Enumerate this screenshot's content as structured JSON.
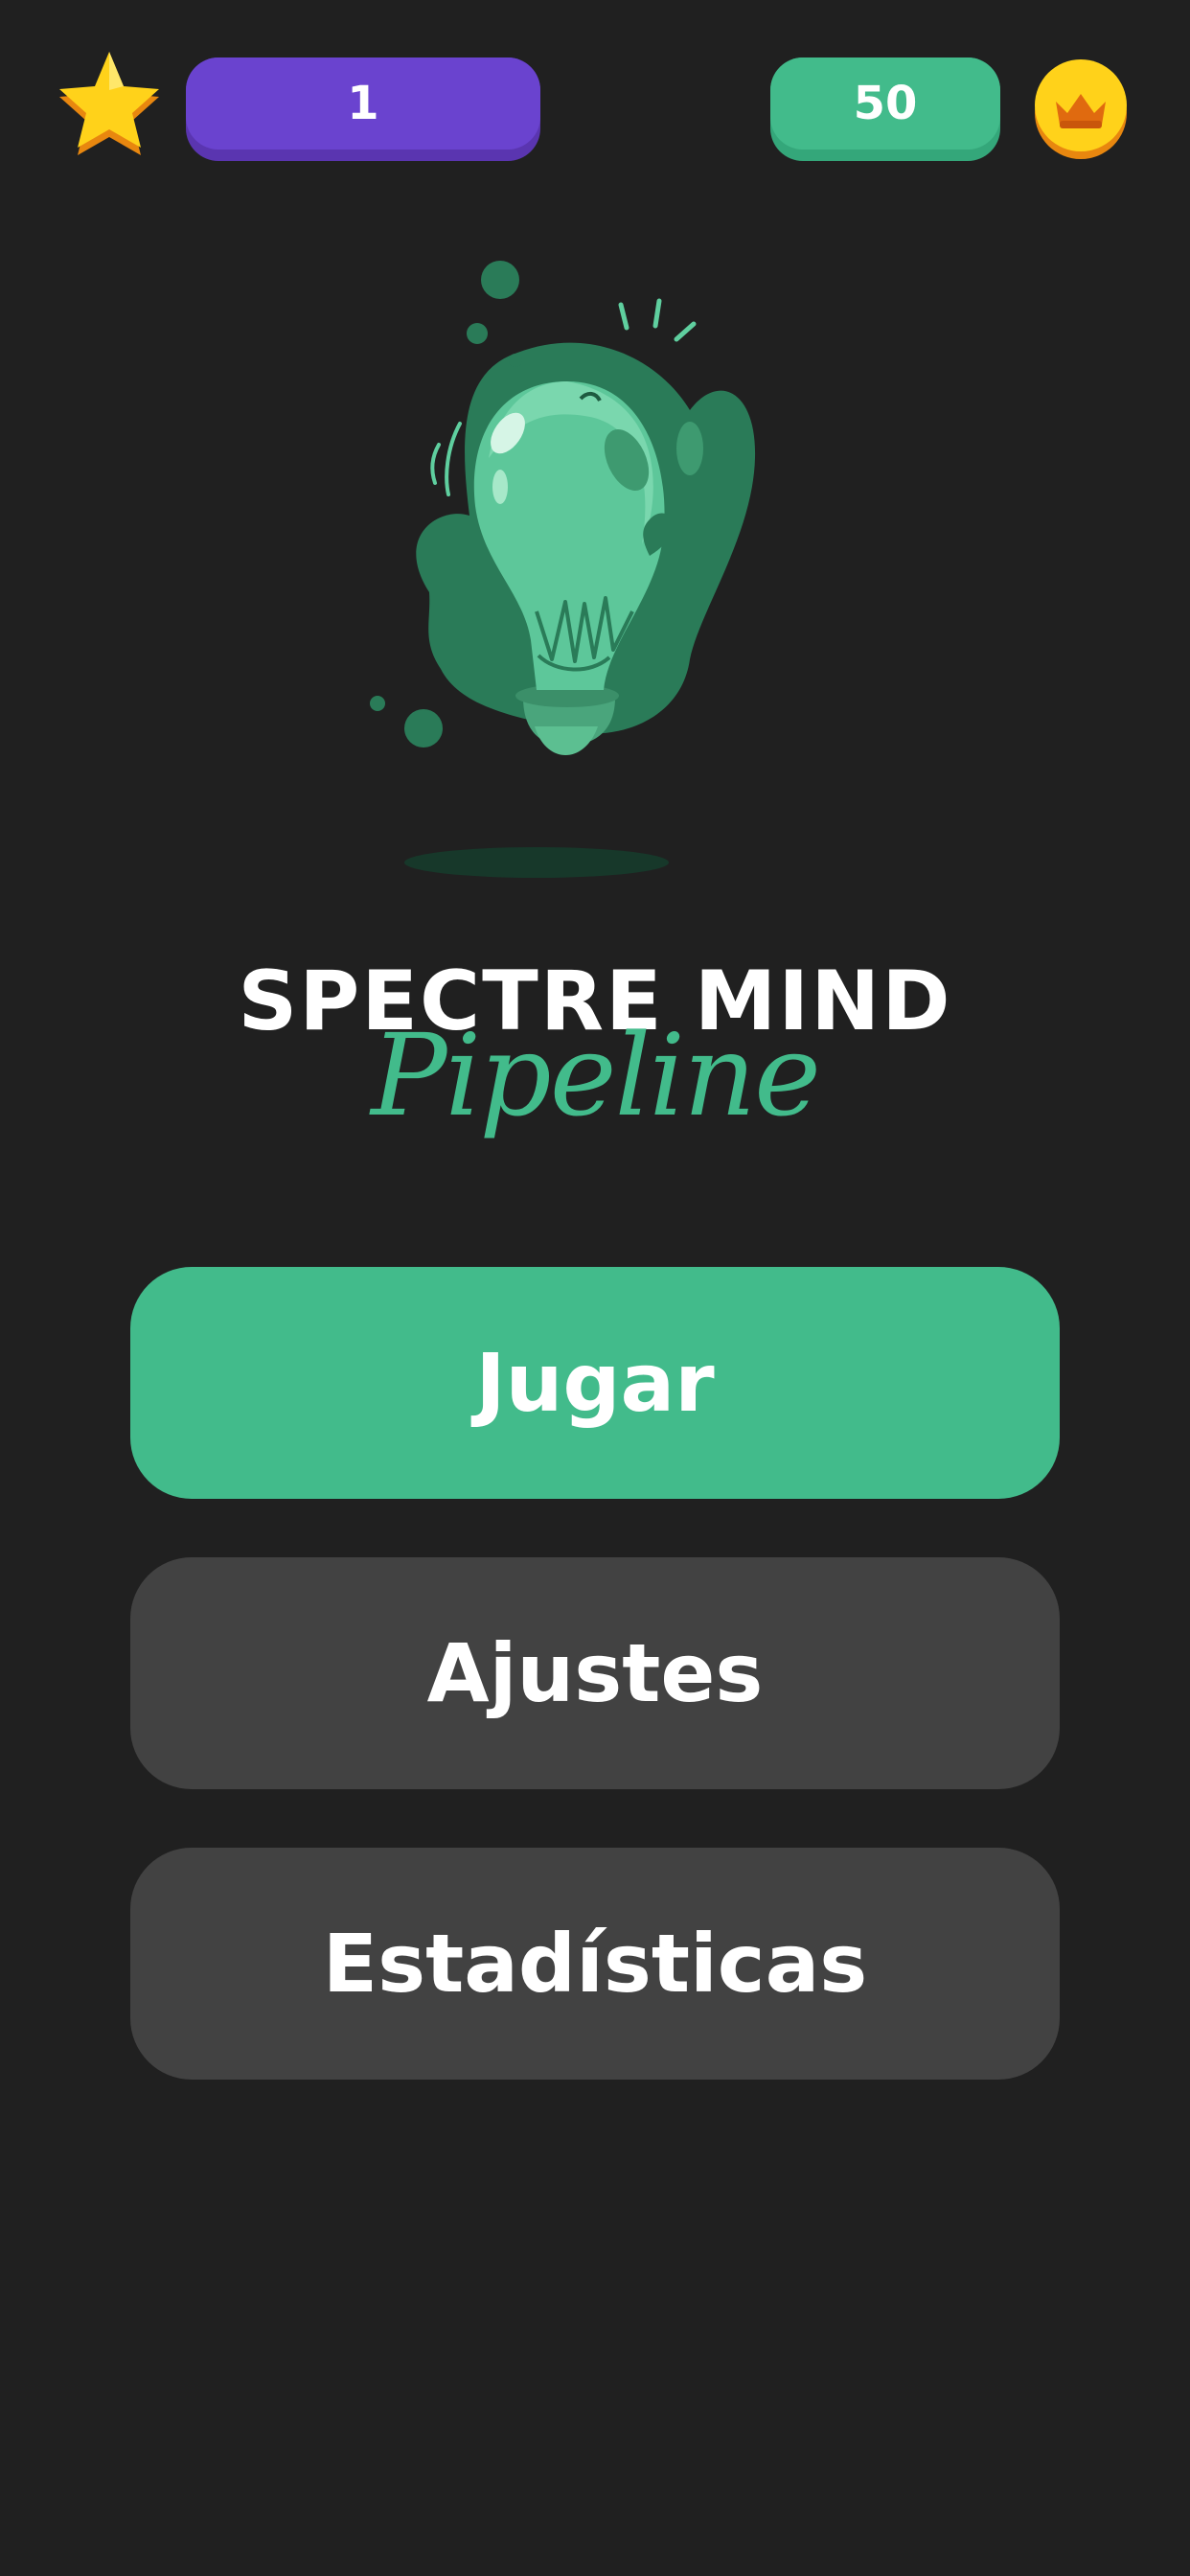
{
  "header": {
    "level_value": "1",
    "coins_value": "50",
    "star_icon": "star-icon",
    "coin_icon": "crown-coin-icon"
  },
  "illustration": {
    "icon": "lightbulb-slime-icon"
  },
  "title": {
    "main": "SPECTRE MIND",
    "sub": "Pipeline"
  },
  "menu": {
    "play_label": "Jugar",
    "settings_label": "Ajustes",
    "stats_label": "Estadísticas"
  },
  "colors": {
    "background": "#202020",
    "accent_green": "#42bb8b",
    "level_purple": "#6a43cf",
    "button_gray": "#424242",
    "star_yellow": "#ffd21a",
    "coin_orange": "#f29a12"
  }
}
